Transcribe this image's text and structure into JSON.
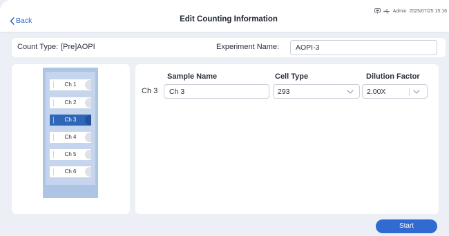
{
  "header": {
    "back_label": "Back",
    "title": "Edit Counting Information",
    "user": "Admin",
    "datetime": "2025/07/25 15:16"
  },
  "icons": {
    "back": "chevron-left-icon",
    "status": [
      "network-icon",
      "usb-icon"
    ],
    "dropdown": "chevron-down-icon"
  },
  "count_type": {
    "label": "Count Type:",
    "value": "[Pre]AOPI"
  },
  "experiment": {
    "label": "Experiment Name:",
    "value": "AOPI-3"
  },
  "slide": {
    "channels": [
      {
        "label": "Ch 1",
        "selected": false
      },
      {
        "label": "Ch 2",
        "selected": false
      },
      {
        "label": "Ch 3",
        "selected": true
      },
      {
        "label": "Ch 4",
        "selected": false
      },
      {
        "label": "Ch 5",
        "selected": false
      },
      {
        "label": "Ch 6",
        "selected": false
      }
    ]
  },
  "sample_table": {
    "headers": {
      "sample_name": "Sample Name",
      "cell_type": "Cell Type",
      "dilution_factor": "Dilution Factor"
    },
    "row": {
      "channel": "Ch 3",
      "sample_name": "Ch 3",
      "cell_type": "293",
      "dilution_factor": "2.00X"
    }
  },
  "actions": {
    "start_label": "Start"
  },
  "colors": {
    "accent": "#2f6bd1",
    "back_link": "#2a66c6",
    "selected_channel": "#2f66b8",
    "slide": "#adc4e4",
    "slide_inner": "#c4d5ed"
  }
}
